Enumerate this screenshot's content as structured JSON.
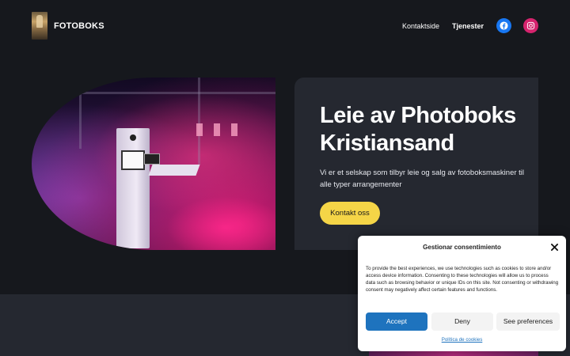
{
  "header": {
    "site_title": "FOTOBOKS",
    "nav": [
      {
        "label": "Kontaktside"
      },
      {
        "label": "Tjenester"
      }
    ],
    "social": [
      {
        "icon": "facebook-icon",
        "color": "#1877f2"
      },
      {
        "icon": "instagram-icon",
        "color": "#d6246e"
      }
    ]
  },
  "hero": {
    "title_line1": "Leie av Photoboks",
    "title_line2": "Kristiansand",
    "text": "Vi er et selskap som tilbyr leie og salg av fotoboksmaskiner til alle typer arrangementer",
    "cta_label": "Kontakt oss",
    "cta_color": "#f5d547"
  },
  "consent": {
    "title": "Gestionar consentimiento",
    "text": "To provide the best experiences, we use technologies such as cookies to store and/or access device information. Consenting to these technologies will allow us to process data such as browsing behavior or unique IDs on this site. Not consenting or withdrawing consent may negatively affect certain features and functions.",
    "accept_label": "Accept",
    "deny_label": "Deny",
    "preferences_label": "See preferences",
    "policy_link": "Política de cookies",
    "accent_color": "#1e73be"
  },
  "colors": {
    "background": "#16181d",
    "card": "#252830"
  }
}
